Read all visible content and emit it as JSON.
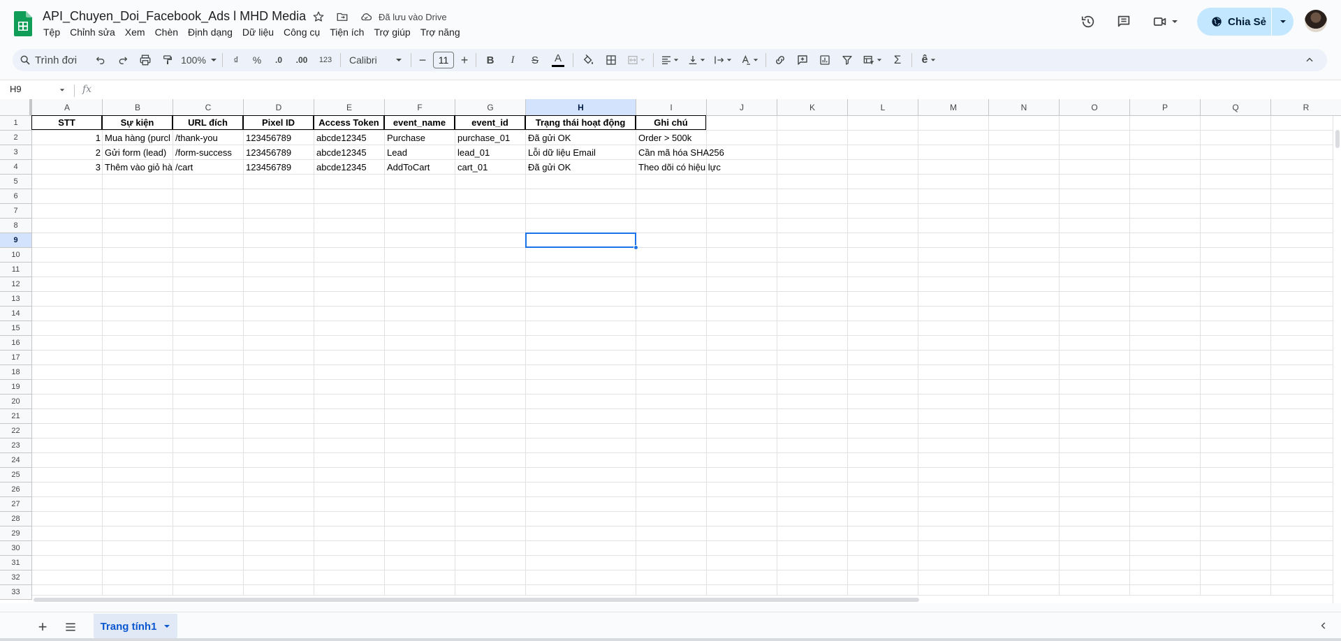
{
  "header": {
    "title": "API_Chuyen_Doi_Facebook_Ads l MHD Media",
    "saved_status": "Đã lưu vào Drive",
    "share_label": "Chia Sẻ",
    "menu": [
      "Tệp",
      "Chỉnh sửa",
      "Xem",
      "Chèn",
      "Định dạng",
      "Dữ liệu",
      "Công cụ",
      "Tiện ích",
      "Trợ giúp",
      "Trợ năng"
    ]
  },
  "toolbar": {
    "search_label": "Trình đơi",
    "zoom": "100%",
    "currency": "₫",
    "percent": "%",
    "decrease_decimal": ".0",
    "increase_decimal": ".00",
    "number_format": "123",
    "font": "Calibri",
    "font_size": "11",
    "bold": "B",
    "italic": "I",
    "strike": "S",
    "text_color": "A"
  },
  "formula_bar": {
    "name_box": "H9",
    "fx": "fx",
    "value": ""
  },
  "columns": [
    "A",
    "B",
    "C",
    "D",
    "E",
    "F",
    "G",
    "H",
    "I",
    "J",
    "K",
    "L",
    "M",
    "N",
    "O",
    "P",
    "Q",
    "R"
  ],
  "rows": [
    "1",
    "2",
    "3",
    "4",
    "5",
    "6",
    "7",
    "8",
    "9",
    "10",
    "11",
    "12",
    "13",
    "14",
    "15",
    "16",
    "17",
    "18",
    "19",
    "20",
    "21",
    "22",
    "23",
    "24",
    "25",
    "26",
    "27",
    "28",
    "29",
    "30",
    "31",
    "32",
    "33"
  ],
  "selected_cell": "H9",
  "sheet": {
    "header": [
      "STT",
      "Sự kiện",
      "URL đích",
      "Pixel ID",
      "Access Token",
      "event_name",
      "event_id",
      "Trạng thái hoạt động",
      "Ghi chú"
    ],
    "data": [
      [
        "1",
        "Mua hàng (purcl",
        "/thank-you",
        "123456789",
        "abcde12345",
        "Purchase",
        "purchase_01",
        "Đã gửi OK",
        "Order > 500k"
      ],
      [
        "2",
        "Gửi form (lead)",
        "/form-success",
        "123456789",
        "abcde12345",
        "Lead",
        "lead_01",
        "Lỗi dữ liệu Email",
        "Cần mã hóa SHA256"
      ],
      [
        "3",
        "Thêm vào giỏ hà",
        "/cart",
        "123456789",
        "abcde12345",
        "AddToCart",
        "cart_01",
        "Đã gửi OK",
        "Theo dõi có hiệu lực"
      ]
    ]
  },
  "sheet_tab": "Trang tính1",
  "colors": {
    "accent": "#0b57d0",
    "share_bg": "#c2e7ff",
    "selection": "#1a73e8",
    "header_selected": "#d3e3fd",
    "logo": "#0f9d58"
  }
}
